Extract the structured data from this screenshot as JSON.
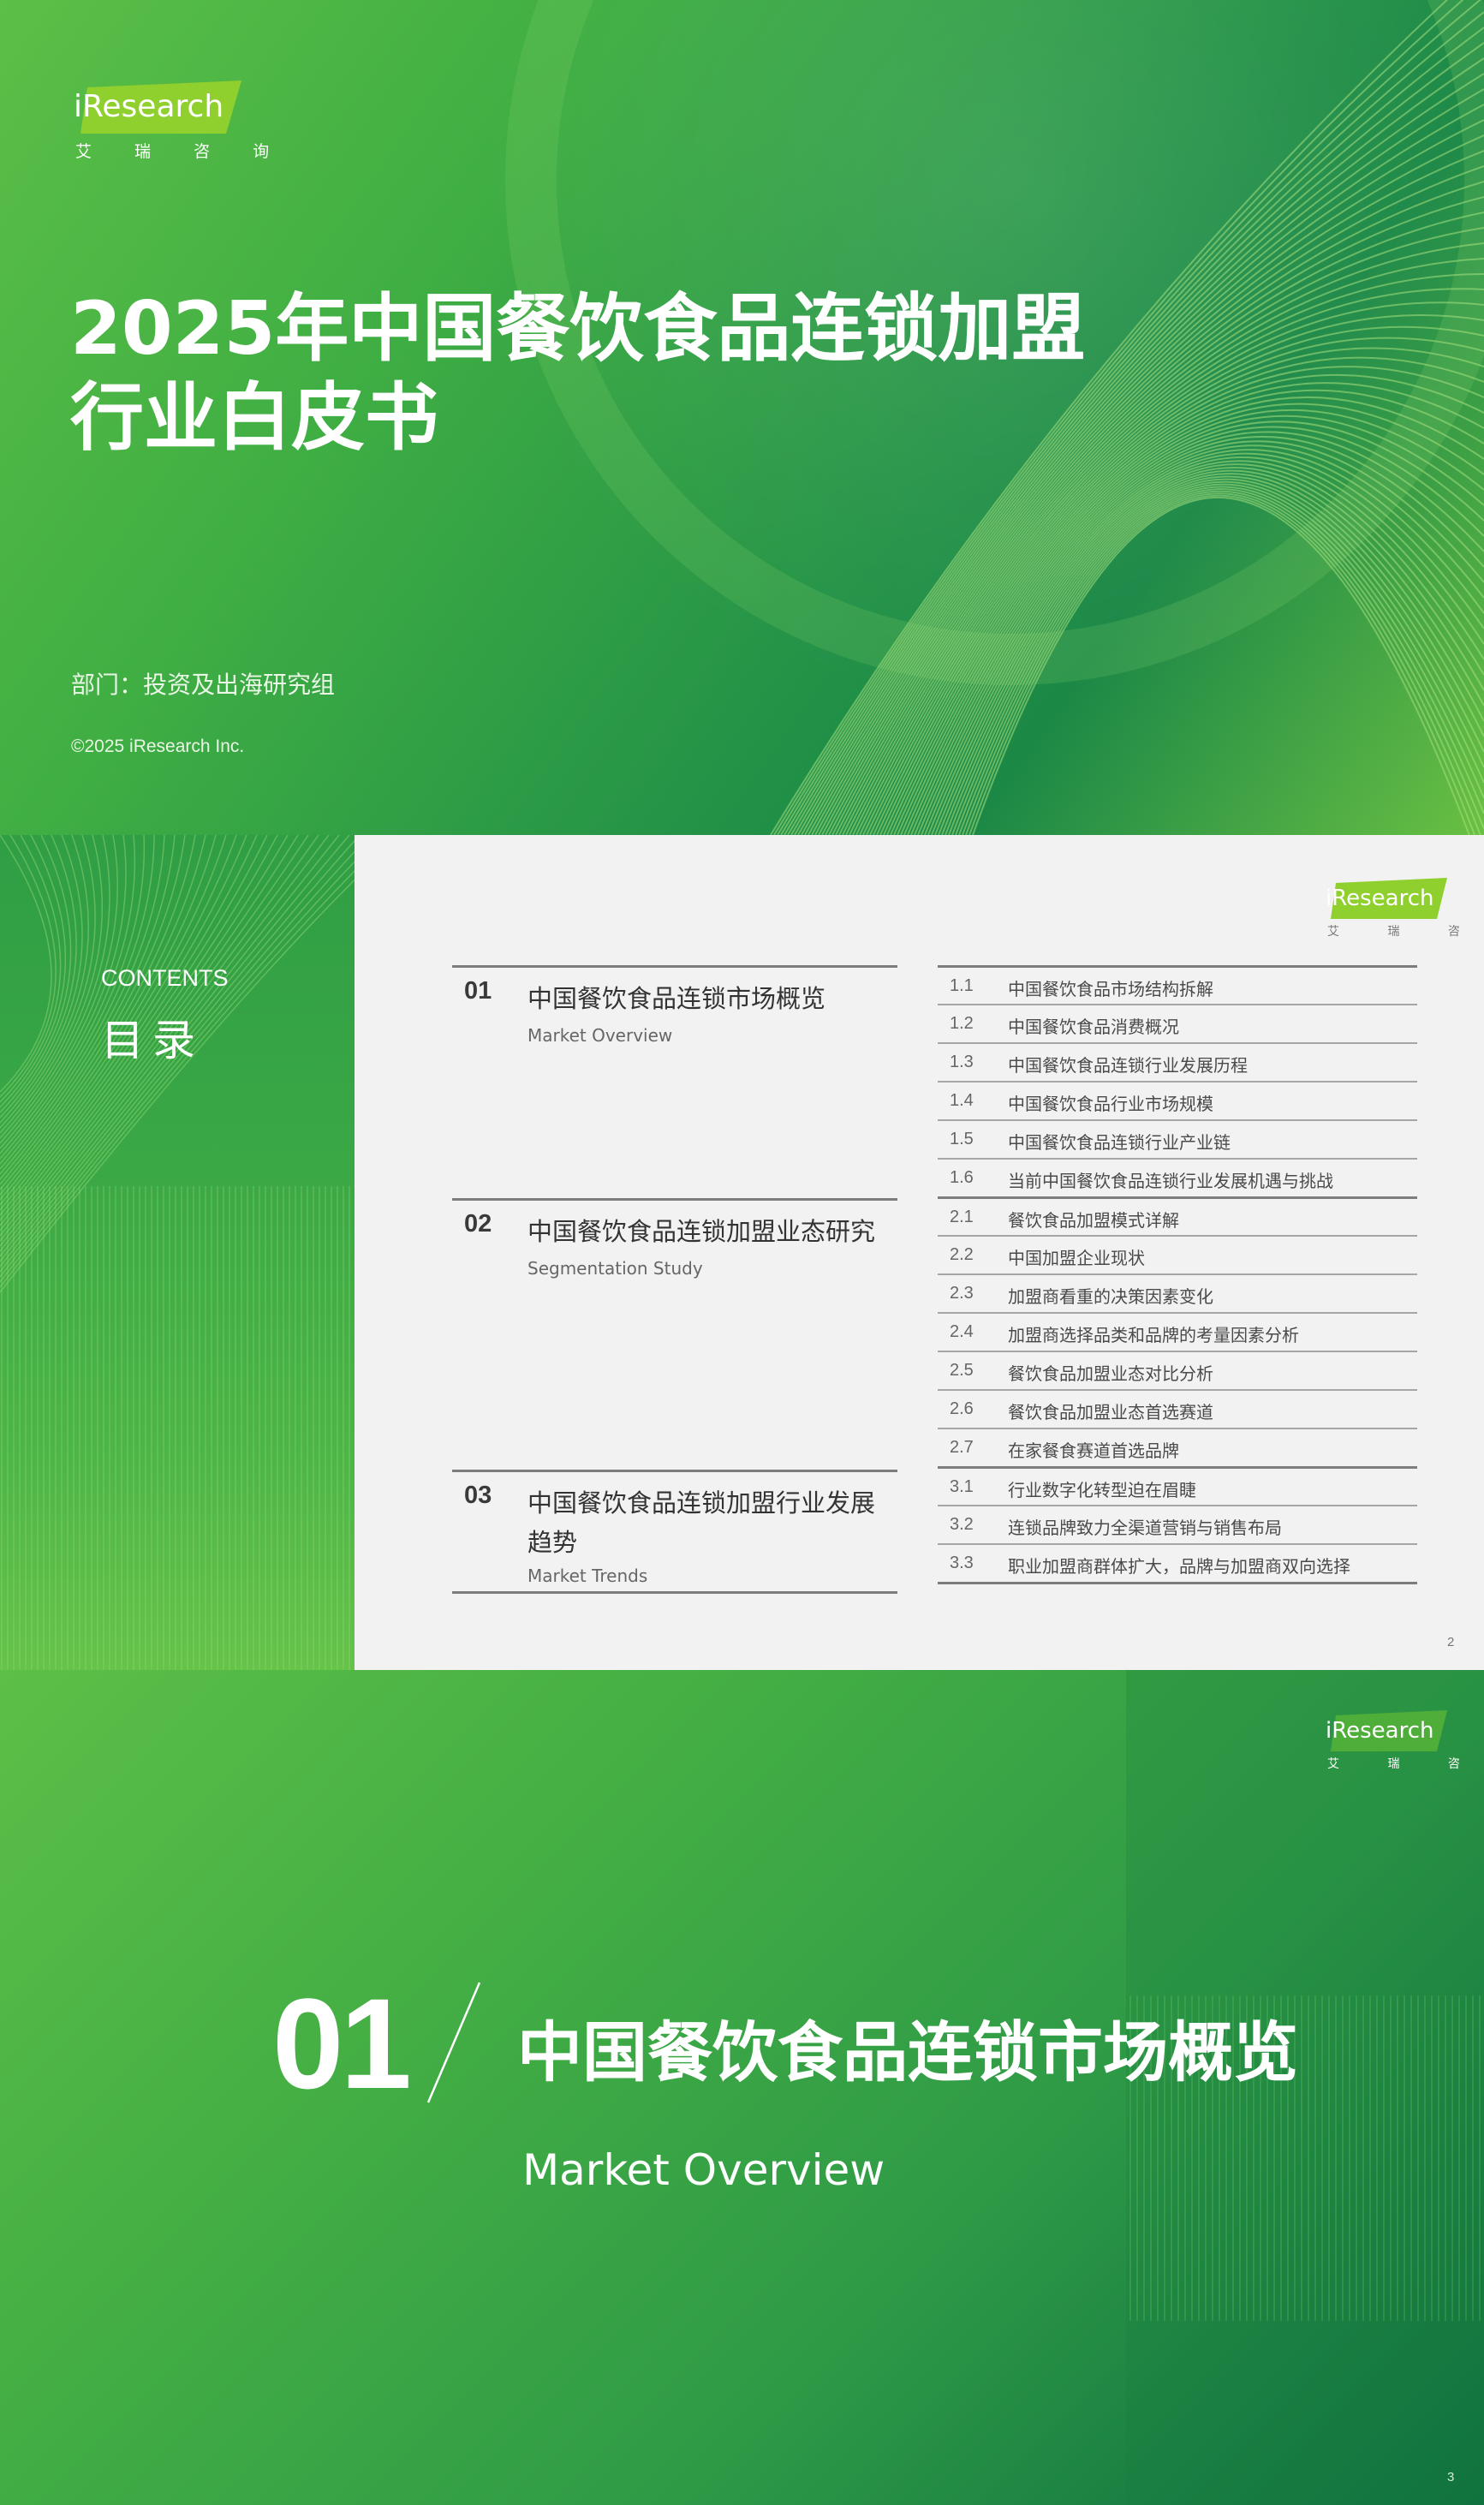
{
  "brand": {
    "logo_text": "iResearch",
    "logo_cn": "艾 瑞 咨 询",
    "green_dark": "#1b8846",
    "green_mid": "#3fae43",
    "green_light": "#6ac042"
  },
  "cover": {
    "title_line1": "2025年中国餐饮食品连锁加盟",
    "title_line2": "行业白皮书",
    "department": "部门：投资及出海研究组",
    "copyright": "©2025 iResearch Inc."
  },
  "contents": {
    "label_en": "CONTENTS",
    "label_cn": "目录",
    "sections": [
      {
        "num": "01",
        "title": "中国餐饮食品连锁市场概览",
        "en": "Market Overview"
      },
      {
        "num": "02",
        "title": "中国餐饮食品连锁加盟业态研究",
        "en": "Segmentation Study"
      },
      {
        "num": "03",
        "title": "中国餐饮食品连锁加盟行业发展趋势",
        "en": "Market Trends"
      }
    ],
    "items": [
      {
        "num": "1.1",
        "text": "中国餐饮食品市场结构拆解"
      },
      {
        "num": "1.2",
        "text": "中国餐饮食品消费概况"
      },
      {
        "num": "1.3",
        "text": "中国餐饮食品连锁行业发展历程"
      },
      {
        "num": "1.4",
        "text": "中国餐饮食品行业市场规模"
      },
      {
        "num": "1.5",
        "text": "中国餐饮食品连锁行业产业链"
      },
      {
        "num": "1.6",
        "text": "当前中国餐饮食品连锁行业发展机遇与挑战"
      },
      {
        "num": "2.1",
        "text": "餐饮食品加盟模式详解"
      },
      {
        "num": "2.2",
        "text": "中国加盟企业现状"
      },
      {
        "num": "2.3",
        "text": "加盟商看重的决策因素变化"
      },
      {
        "num": "2.4",
        "text": "加盟商选择品类和品牌的考量因素分析"
      },
      {
        "num": "2.5",
        "text": "餐饮食品加盟业态对比分析"
      },
      {
        "num": "2.6",
        "text": "餐饮食品加盟业态首选赛道"
      },
      {
        "num": "2.7",
        "text": "在家餐食赛道首选品牌"
      },
      {
        "num": "3.1",
        "text": "行业数字化转型迫在眉睫"
      },
      {
        "num": "3.2",
        "text": "连锁品牌致力全渠道营销与销售布局"
      },
      {
        "num": "3.3",
        "text": "职业加盟商群体扩大，品牌与加盟商双向选择"
      }
    ],
    "page_number": "2"
  },
  "section1": {
    "num": "01",
    "title": "中国餐饮食品连锁市场概览",
    "en": "Market Overview",
    "page_number": "3"
  }
}
